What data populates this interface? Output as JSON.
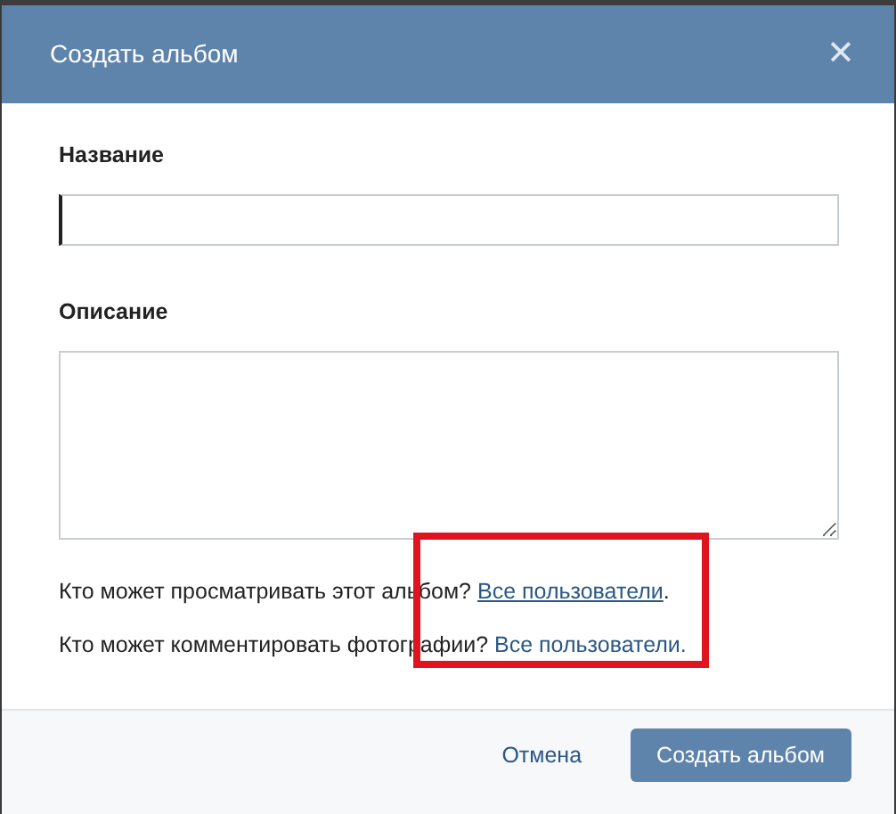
{
  "dialog": {
    "title": "Создать альбом",
    "close": "✕"
  },
  "fields": [
    {
      "kind": "input",
      "label": "Название",
      "focused": true
    },
    {
      "kind": "textarea",
      "label": "Описание",
      "focused": false
    }
  ],
  "privacy": {
    "highlighted": true,
    "rows": [
      {
        "question": "Кто может просматривать этот альбом?",
        "link": "Все пользователи",
        "hovered": true,
        "tail": "."
      },
      {
        "question": "Кто может комментировать фотографии?",
        "link": "Все пользователи.",
        "hovered": false,
        "tail": ""
      }
    ]
  },
  "buttons": [
    {
      "kind": "secondary",
      "label": "Отмена"
    },
    {
      "kind": "primary",
      "label": "Создать альбом"
    }
  ]
}
